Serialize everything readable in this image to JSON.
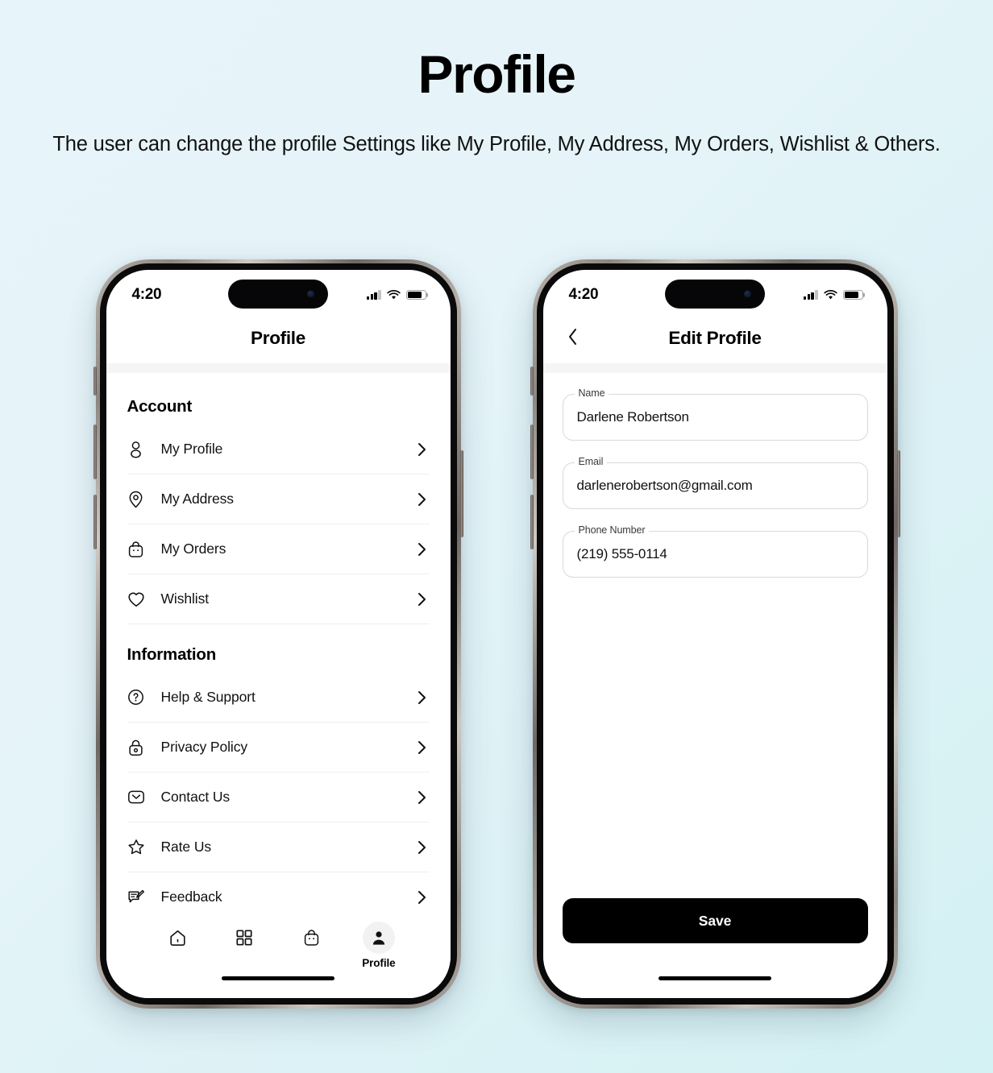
{
  "page": {
    "title": "Profile",
    "subtitle": "The user can change the profile Settings like My Profile, My Address, My Orders, Wishlist & Others.",
    "background_start": "#e7f4fa",
    "background_end": "#d4f1f3"
  },
  "status_bar": {
    "time": "4:20",
    "cellular_icon": "signal-bars-icon",
    "wifi_icon": "wifi-icon",
    "battery_icon": "battery-icon"
  },
  "screen_profile": {
    "nav": {
      "title": "Profile"
    },
    "sections": [
      {
        "heading": "Account",
        "items": [
          {
            "label": "My Profile",
            "icon": "user-icon",
            "chevron": "chevron-right-icon"
          },
          {
            "label": "My Address",
            "icon": "location-pin-icon",
            "chevron": "chevron-right-icon"
          },
          {
            "label": "My Orders",
            "icon": "shopping-bag-icon",
            "chevron": "chevron-right-icon"
          },
          {
            "label": "Wishlist",
            "icon": "heart-icon",
            "chevron": "chevron-right-icon"
          }
        ]
      },
      {
        "heading": "Information",
        "items": [
          {
            "label": "Help & Support",
            "icon": "question-circle-icon",
            "chevron": "chevron-right-icon"
          },
          {
            "label": "Privacy Policy",
            "icon": "lock-icon",
            "chevron": "chevron-right-icon"
          },
          {
            "label": "Contact Us",
            "icon": "envelope-icon",
            "chevron": "chevron-right-icon"
          },
          {
            "label": "Rate Us",
            "icon": "star-icon",
            "chevron": "chevron-right-icon"
          },
          {
            "label": "Feedback",
            "icon": "feedback-message-icon",
            "chevron": "chevron-right-icon"
          }
        ]
      }
    ],
    "tabs": [
      {
        "label": "",
        "icon": "home-icon",
        "active": false
      },
      {
        "label": "",
        "icon": "categories-grid-icon",
        "active": false
      },
      {
        "label": "",
        "icon": "shopping-bag-icon",
        "active": false
      },
      {
        "label": "Profile",
        "icon": "person-filled-icon",
        "active": true
      }
    ]
  },
  "screen_edit_profile": {
    "nav": {
      "title": "Edit Profile",
      "back_icon": "chevron-left-icon"
    },
    "fields": [
      {
        "label": "Name",
        "value": "Darlene Robertson"
      },
      {
        "label": "Email",
        "value": "darlenerobertson@gmail.com"
      },
      {
        "label": "Phone Number",
        "value": "(219) 555-0114"
      }
    ],
    "save_label": "Save"
  }
}
